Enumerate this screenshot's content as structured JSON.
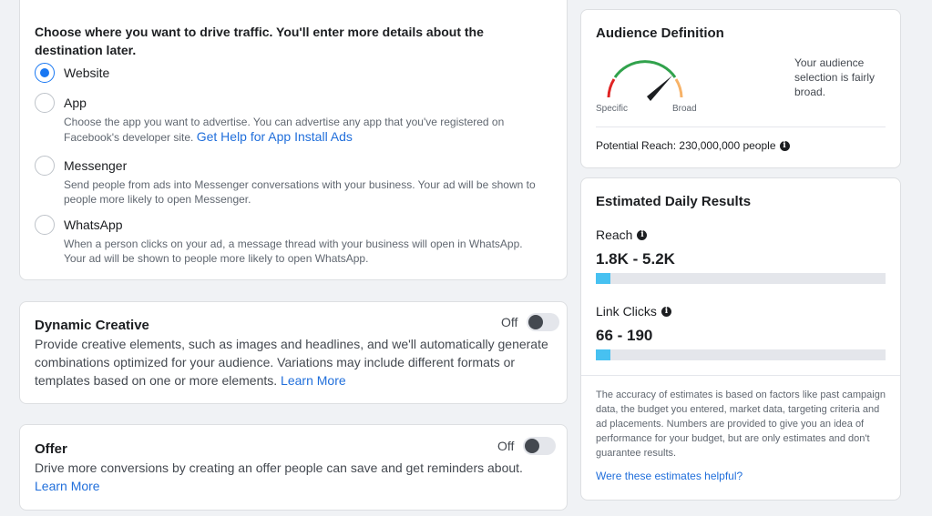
{
  "traffic": {
    "title": "Choose where you want to drive traffic. You'll enter more details about the destination later.",
    "options": [
      {
        "label": "Website",
        "selected": true,
        "description": "",
        "link": ""
      },
      {
        "label": "App",
        "selected": false,
        "description": "Choose the app you want to advertise. You can advertise any app that you've registered on Facebook's developer site.",
        "link": "Get Help for App Install Ads"
      },
      {
        "label": "Messenger",
        "selected": false,
        "description": "Send people from ads into Messenger conversations with your business. Your ad will be shown to people more likely to open Messenger.",
        "link": ""
      },
      {
        "label": "WhatsApp",
        "selected": false,
        "description": "When a person clicks on your ad, a message thread with your business will open in WhatsApp. Your ad will be shown to people more likely to open WhatsApp.",
        "link": ""
      }
    ]
  },
  "dynamic_creative": {
    "title": "Dynamic Creative",
    "toggle_state": "Off",
    "description": "Provide creative elements, such as images and headlines, and we'll automatically generate combinations optimized for your audience. Variations may include different formats or templates based on one or more elements.",
    "link": "Learn More"
  },
  "offer": {
    "title": "Offer",
    "toggle_state": "Off",
    "description": "Drive more conversions by creating an offer people can save and get reminders about.",
    "link": "Learn More"
  },
  "audience": {
    "title": "Audience Definition",
    "gauge_left": "Specific",
    "gauge_right": "Broad",
    "description": "Your audience selection is fairly broad.",
    "potential_reach": "Potential Reach: 230,000,000 people"
  },
  "estimates": {
    "title": "Estimated Daily Results",
    "reach_label": "Reach",
    "reach_value": "1.8K - 5.2K",
    "reach_fill": 0.05,
    "clicks_label": "Link Clicks",
    "clicks_value": "66 - 190",
    "clicks_fill": 0.05,
    "disclaimer": "The accuracy of estimates is based on factors like past campaign data, the budget you entered, market data, targeting criteria and ad placements. Numbers are provided to give you an idea of performance for your budget, but are only estimates and don't guarantee results.",
    "helpful_link": "Were these estimates helpful?"
  },
  "colors": {
    "accent": "#1877f2",
    "link": "#216fdb",
    "bar_fill": "#47c1f1",
    "gauge_green": "#31a24c",
    "gauge_red": "#e02424",
    "gauge_orange": "#f7b267"
  },
  "icons": [
    "info-icon",
    "gauge-icon",
    "radio-icon",
    "toggle-icon"
  ]
}
